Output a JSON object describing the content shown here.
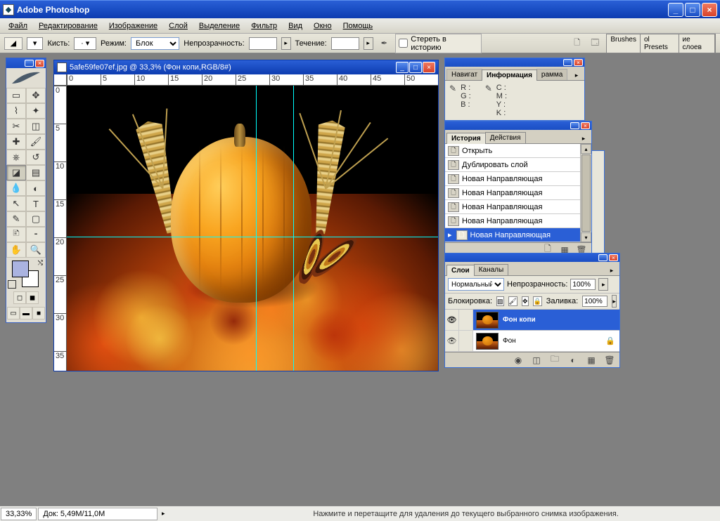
{
  "app": {
    "title": "Adobe Photoshop"
  },
  "menu": [
    "Файл",
    "Редактирование",
    "Изображение",
    "Слой",
    "Выделение",
    "Фильтр",
    "Вид",
    "Окно",
    "Помощь"
  ],
  "options": {
    "brush_label": "Кисть:",
    "mode_label": "Режим:",
    "mode_value": "Блок",
    "opacity_label": "Непрозрачность:",
    "flow_label": "Течение:",
    "erase_history": "Стереть в историю",
    "tabs": [
      "Brushes",
      "ol Presets",
      "ие слоев"
    ]
  },
  "document": {
    "title": "5afe59fe07ef.jpg @ 33,3% (Фон копи,RGB/8#)",
    "ruler_h": [
      "0",
      "5",
      "10",
      "15",
      "20",
      "25",
      "30",
      "35",
      "40",
      "45",
      "50"
    ],
    "ruler_v": [
      "0",
      "5",
      "10",
      "15",
      "20",
      "25",
      "30",
      "35"
    ],
    "guides": {
      "v": [
        51,
        61
      ],
      "h": [
        53
      ]
    }
  },
  "info_panel": {
    "tabs": [
      "Навигат",
      "Информация",
      "раммa"
    ],
    "rgb": [
      "R :",
      "G :",
      "B :"
    ],
    "cmyk": [
      "C :",
      "M :",
      "Y :",
      "K :"
    ]
  },
  "history_panel": {
    "tabs": [
      "История",
      "Действия"
    ],
    "items": [
      "Открыть",
      "Дублировать слой",
      "Новая Направляющая",
      "Новая Направляющая",
      "Новая Направляющая",
      "Новая Направляющая",
      "Новая Направляющая"
    ],
    "selected_index": 6
  },
  "layers_panel": {
    "tabs": [
      "Слои",
      "Каналы"
    ],
    "blend_mode": "Нормальный",
    "opacity_label": "Непрозрачность:",
    "opacity_value": "100%",
    "lock_label": "Блокировка:",
    "fill_label": "Заливка:",
    "fill_value": "100%",
    "layers": [
      {
        "name": "Фон копи",
        "selected": true
      },
      {
        "name": "Фон",
        "selected": false
      }
    ]
  },
  "statusbar": {
    "zoom": "33,33%",
    "docsize": "Док: 5,49М/11,0М",
    "hint": "Нажмите и перетащите для удаления до текущего выбранного снимка изображения."
  }
}
